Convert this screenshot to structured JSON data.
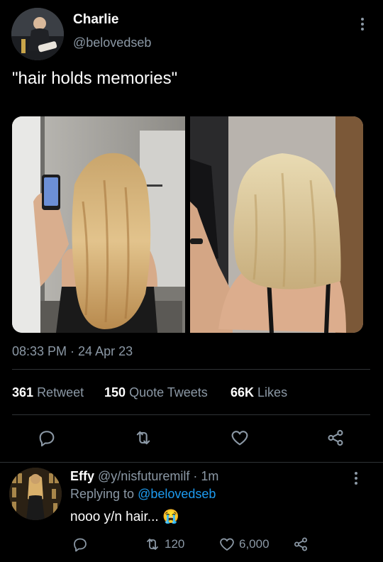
{
  "tweet": {
    "author_name": "Charlie",
    "author_handle": "@belovedseb",
    "text": "\"hair holds memories\"",
    "timestamp": "08:33 PM · 24 Apr 23",
    "stats": {
      "retweets_count": "361",
      "retweets_label": "Retweet",
      "quotes_count": "150",
      "quotes_label": "Quote Tweets",
      "likes_count": "66K",
      "likes_label": "Likes"
    },
    "actions": [
      "reply-icon",
      "retweet-icon",
      "like-icon",
      "share-icon"
    ]
  },
  "reply": {
    "author_name": "Effy",
    "author_handle": "@y/nisfuturemilf",
    "time": "· 1m",
    "replying_prefix": "Replying to",
    "replying_handle": "@belovedseb",
    "text": "nooo y/n hair...",
    "emoji": "😭",
    "retweet_count": "120",
    "like_count": "6,000"
  },
  "colors": {
    "background": "#000000",
    "text": "#e7e9ea",
    "secondary": "#8b98a5",
    "link": "#1d9bf0",
    "divider": "#2f3336"
  }
}
